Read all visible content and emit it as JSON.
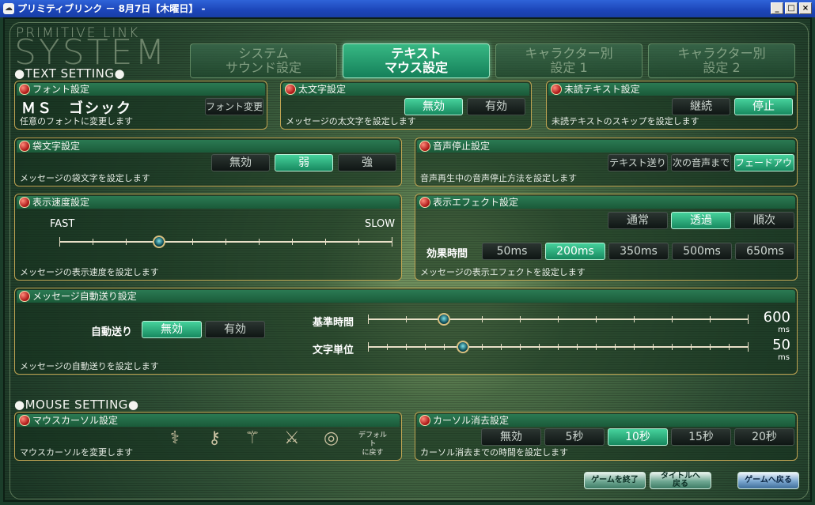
{
  "window": {
    "title": "プリミティブリンク － 8月7日【木曜日】 -",
    "app_icon": "app-icon",
    "controls": {
      "minimize": "_",
      "maximize": "□",
      "close": "×"
    }
  },
  "logo": {
    "small": "PRIMITIVE LINK",
    "big": "SYSTEM"
  },
  "tabs": [
    {
      "line1": "システム",
      "line2": "サウンド設定",
      "active": false
    },
    {
      "line1": "テキスト",
      "line2": "マウス設定",
      "active": true
    },
    {
      "line1": "キャラクター別",
      "line2": "設定 1",
      "active": false
    },
    {
      "line1": "キャラクター別",
      "line2": "設定 2",
      "active": false
    }
  ],
  "text_setting_heading": "●TEXT SETTING●",
  "mouse_setting_heading": "●MOUSE SETTING●",
  "font": {
    "title": "フォント設定",
    "current_font": "ＭＳ　ゴシック",
    "change_button": "フォント変更",
    "description": "任意のフォントに変更します"
  },
  "bold": {
    "title": "太文字設定",
    "options": [
      "無効",
      "有効"
    ],
    "selected": 0,
    "description": "メッセージの太文字を設定します"
  },
  "unread": {
    "title": "未読テキスト設定",
    "options": [
      "継続",
      "停止"
    ],
    "selected": 1,
    "description": "未読テキストのスキップを設定します"
  },
  "outline": {
    "title": "袋文字設定",
    "options": [
      "無効",
      "弱",
      "強"
    ],
    "selected": 1,
    "description": "メッセージの袋文字を設定します"
  },
  "voice_stop": {
    "title": "音声停止設定",
    "options": [
      "テキスト送り",
      "次の音声まで",
      "フェードアウト"
    ],
    "selected": 2,
    "description": "音声再生中の音声停止方法を設定します"
  },
  "speed": {
    "title": "表示速度設定",
    "fast_label": "FAST",
    "slow_label": "SLOW",
    "level_fraction": 0.3,
    "description": "メッセージの表示速度を設定します"
  },
  "effect": {
    "title": "表示エフェクト設定",
    "options": [
      "通常",
      "透過",
      "順次"
    ],
    "selected": 1,
    "time_label": "効果時間",
    "time_options": [
      "50ms",
      "200ms",
      "350ms",
      "500ms",
      "650ms"
    ],
    "time_selected": 1,
    "description": "メッセージの表示エフェクトを設定します"
  },
  "auto": {
    "title": "メッセージ自動送り設定",
    "auto_label": "自動送り",
    "options": [
      "無効",
      "有効"
    ],
    "selected": 0,
    "base_time_label": "基準時間",
    "base_time_value": "600",
    "base_time_unit": "ms",
    "base_time_fraction": 0.2,
    "char_unit_label": "文字単位",
    "char_unit_value": "50",
    "char_unit_unit": "ms",
    "char_unit_fraction": 0.25,
    "description": "メッセージの自動送りを設定します"
  },
  "mouse_cursor": {
    "title": "マウスカーソル設定",
    "default_label_1": "デフォルト",
    "default_label_2": "に戻す",
    "description": "マウスカーソルを変更します"
  },
  "cursor_hide": {
    "title": "カーソル消去設定",
    "options": [
      "無効",
      "5秒",
      "10秒",
      "15秒",
      "20秒"
    ],
    "selected": 2,
    "description": "カーソル消去までの時間を設定します"
  },
  "footer": {
    "quit_game": "ゲームを終了",
    "to_title_1": "タイトルへ",
    "to_title_2": "戻る",
    "back_to_game": "ゲームへ戻る"
  }
}
